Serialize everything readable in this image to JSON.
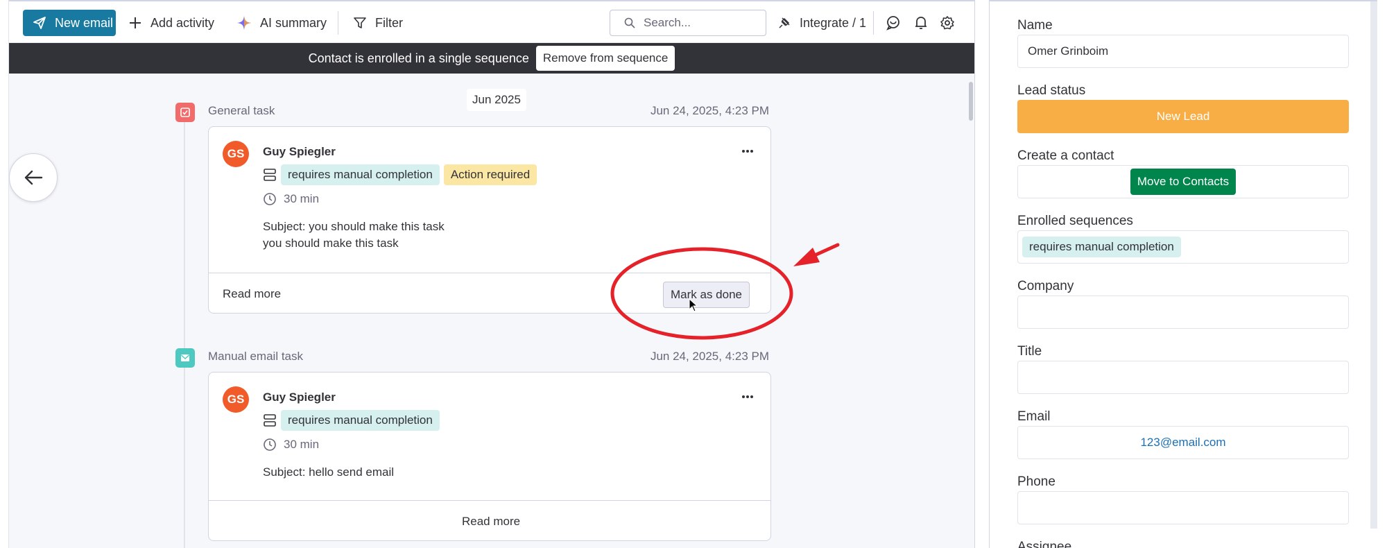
{
  "toolbar": {
    "new_email": "New email",
    "add_activity": "Add activity",
    "ai_summary": "AI summary",
    "filter": "Filter",
    "search_placeholder": "Search...",
    "integrate": "Integrate / 1"
  },
  "banner": {
    "text": "Contact is enrolled in a single sequence",
    "action": "Remove from sequence"
  },
  "timeline": {
    "month": "Jun 2025",
    "tasks": [
      {
        "type": "General task",
        "date": "Jun 24, 2025, 4:23 PM",
        "icon": "check-square-icon",
        "icon_color": "#f26b6b",
        "avatar": "GS",
        "author": "Guy Spiegler",
        "sequence_tag": "requires manual completion",
        "status_tag": "Action required",
        "duration": "30 min",
        "subject": "Subject: you should make this task",
        "body": "you should make this task",
        "read_more": "Read more",
        "action": "Mark as done"
      },
      {
        "type": "Manual email task",
        "date": "Jun 24, 2025, 4:23 PM",
        "icon": "envelope-icon",
        "icon_color": "#4ec9c2",
        "avatar": "GS",
        "author": "Guy Spiegler",
        "sequence_tag": "requires manual completion",
        "duration": "30 min",
        "subject": "Subject: hello send email",
        "read_more": "Read more"
      }
    ]
  },
  "sidebar": {
    "name_label": "Name",
    "name_value": "Omer Grinboim",
    "lead_status_label": "Lead status",
    "lead_status_value": "New Lead",
    "create_contact_label": "Create a contact",
    "move_to_contacts": "Move to Contacts",
    "enrolled_label": "Enrolled sequences",
    "enrolled_value": "requires manual completion",
    "company_label": "Company",
    "company_value": "",
    "title_label": "Title",
    "title_value": "",
    "email_label": "Email",
    "email_value": "123@email.com",
    "phone_label": "Phone",
    "phone_value": "",
    "assignee_label": "Assignee"
  },
  "colors": {
    "brand": "#187aa0",
    "lead_status": "#f9ad45",
    "move_button": "#00854d",
    "annotation": "#e5212a"
  }
}
